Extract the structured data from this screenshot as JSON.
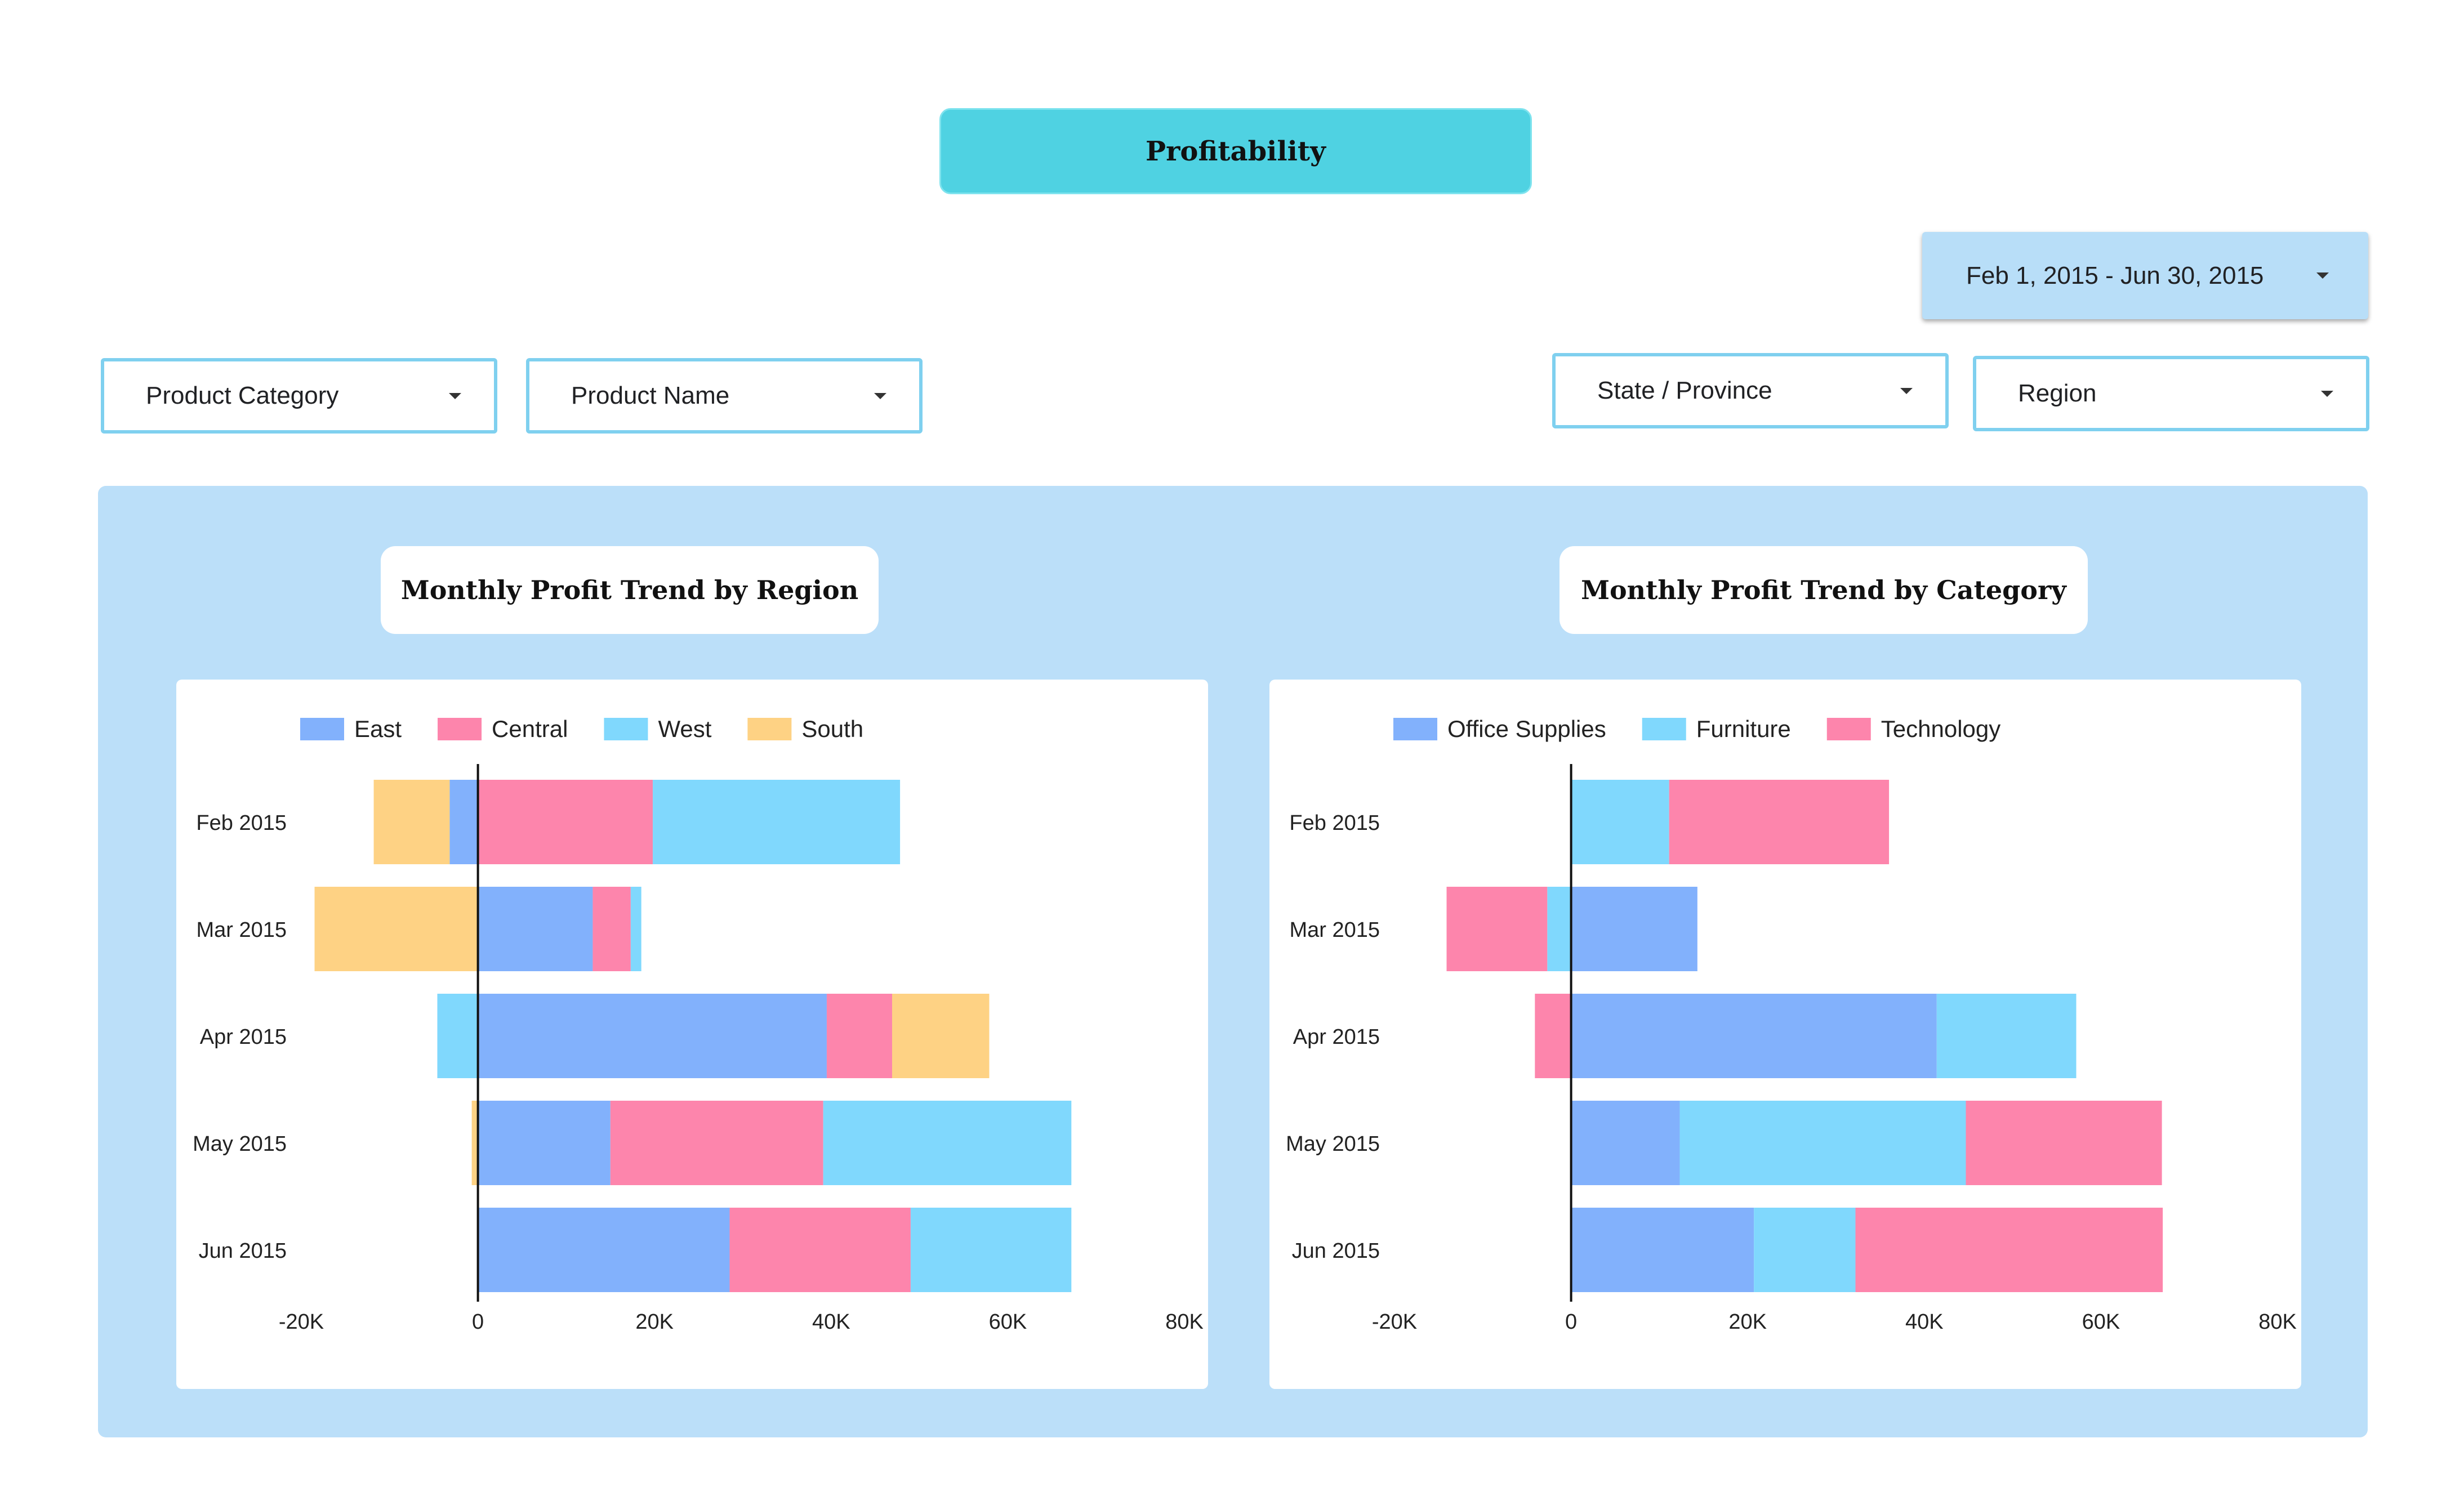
{
  "header": {
    "title": "Profitability"
  },
  "filters": {
    "date_range": "Feb 1, 2015 - Jun 30, 2015",
    "product_category": "Product Category",
    "product_name": "Product Name",
    "state_province": "State / Province",
    "region": "Region"
  },
  "colors": {
    "blue": "#82b1fc",
    "pink": "#fd85ac",
    "cyan": "#80d8fd",
    "orange": "#fed284",
    "panel": "#bbdff9",
    "title_bg": "#4fd2e2"
  },
  "chart_data": [
    {
      "type": "bar",
      "orientation": "horizontal",
      "stacked": true,
      "title": "Monthly Profit Trend by Region",
      "categories": [
        "Feb 2015",
        "Mar 2015",
        "Apr 2015",
        "May 2015",
        "Jun 2015"
      ],
      "series": [
        {
          "name": "East",
          "color": "#82b1fc",
          "values": [
            -3200,
            13000,
            39500,
            15000,
            28500
          ]
        },
        {
          "name": "Central",
          "color": "#fd85ac",
          "values": [
            19800,
            4300,
            7400,
            24100,
            20500
          ]
        },
        {
          "name": "West",
          "color": "#80d8fd",
          "values": [
            28000,
            1200,
            -4600,
            28100,
            18200
          ]
        },
        {
          "name": "South",
          "color": "#fed284",
          "values": [
            -8600,
            -18500,
            11000,
            -700,
            0
          ]
        }
      ],
      "xlim": [
        -20000,
        80000
      ],
      "x_ticks": [
        "-20K",
        "0",
        "20K",
        "40K",
        "60K",
        "80K"
      ],
      "legend": "top-left",
      "grid": false
    },
    {
      "type": "bar",
      "orientation": "horizontal",
      "stacked": true,
      "title": "Monthly Profit Trend by Category",
      "categories": [
        "Feb 2015",
        "Mar 2015",
        "Apr 2015",
        "May 2015",
        "Jun 2015"
      ],
      "series": [
        {
          "name": "Office Supplies",
          "color": "#82b1fc",
          "values": [
            0,
            14300,
            41400,
            12300,
            20700
          ]
        },
        {
          "name": "Furniture",
          "color": "#80d8fd",
          "values": [
            11100,
            -2700,
            15800,
            32400,
            11500
          ]
        },
        {
          "name": "Technology",
          "color": "#fd85ac",
          "values": [
            24900,
            -11400,
            -4100,
            22200,
            34800
          ]
        }
      ],
      "xlim": [
        -20000,
        80000
      ],
      "x_ticks": [
        "-20K",
        "0",
        "20K",
        "40K",
        "60K",
        "80K"
      ],
      "legend": "top-left",
      "grid": false
    }
  ]
}
